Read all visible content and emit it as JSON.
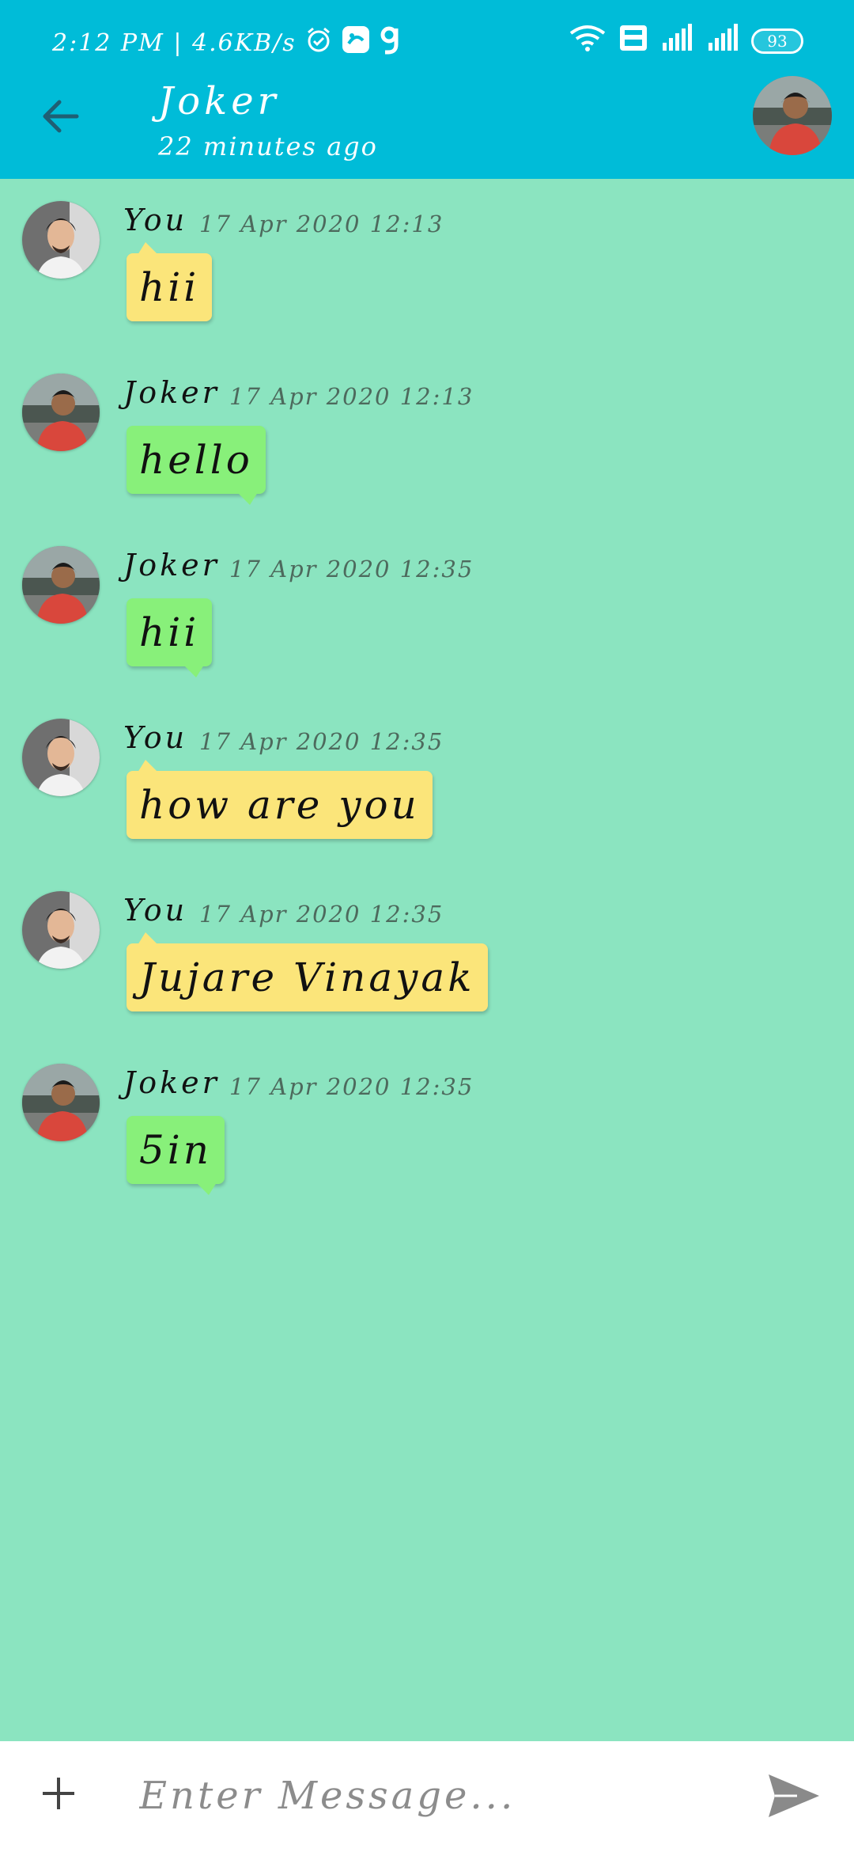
{
  "status_bar": {
    "time_speed": "2:12 PM | 4.6KB/s",
    "battery": "93",
    "icons": [
      "alarm-icon",
      "messenger-icon",
      "g-app-icon",
      "wifi-icon",
      "volte-icon",
      "signal-icon",
      "signal-icon"
    ]
  },
  "header": {
    "title": "Joker",
    "subtitle": "22 minutes ago",
    "back_icon": "arrow-left-icon",
    "avatar": "contact-avatar"
  },
  "colors": {
    "app_bar": "#00bcd8",
    "chat_background": "#8be4c0",
    "my_bubble": "#fbe57a",
    "their_bubble": "#88f07a"
  },
  "messages": [
    {
      "sender": "You",
      "time": "17 Apr 2020 12:13",
      "text": "hii",
      "mine": true
    },
    {
      "sender": "Joker",
      "time": "17 Apr 2020 12:13",
      "text": "hello",
      "mine": false
    },
    {
      "sender": "Joker",
      "time": "17 Apr 2020 12:35",
      "text": "hii",
      "mine": false
    },
    {
      "sender": "You",
      "time": "17 Apr 2020 12:35",
      "text": "how are you",
      "mine": true
    },
    {
      "sender": "You",
      "time": "17 Apr 2020 12:35",
      "text": "Jujare Vinayak",
      "mine": true
    },
    {
      "sender": "Joker",
      "time": "17 Apr 2020 12:35",
      "text": "5in",
      "mine": false
    }
  ],
  "composer": {
    "placeholder": "Enter Message...",
    "value": "",
    "attach_icon": "plus-icon",
    "send_icon": "send-icon"
  }
}
